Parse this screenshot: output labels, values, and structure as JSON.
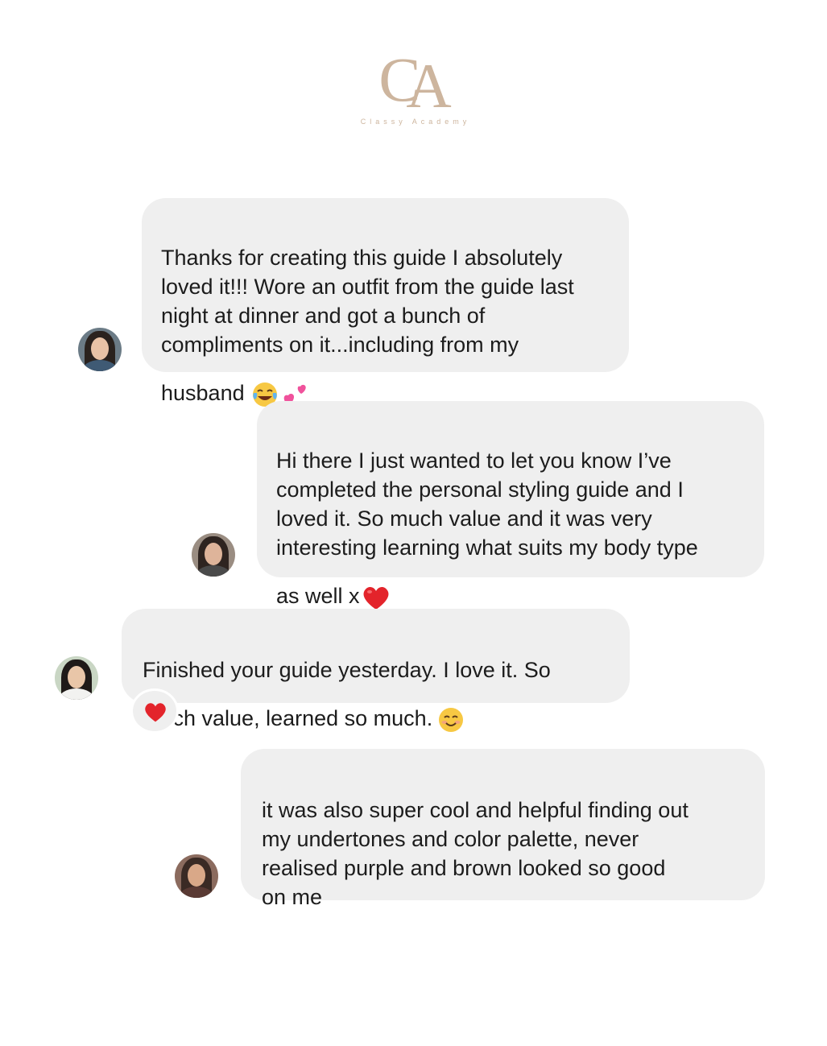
{
  "brand": {
    "monogram_c": "C",
    "monogram_a": "A",
    "name": "Classy Academy",
    "color": "#cdb59e"
  },
  "messages": [
    {
      "side": "left",
      "text": "Thanks for creating this guide I absolutely\nloved it!!! Wore an outfit from the guide last\nnight at dinner and got a bunch of\ncompliments on it...including from my\nhusband",
      "trailing_icons": [
        "tears-of-joy-emoji",
        "two-hearts-emoji"
      ]
    },
    {
      "side": "right",
      "text": "Hi there I just wanted to let you know I’ve\ncompleted the personal styling guide and I\nloved it. So much value and it was very\ninteresting learning what suits my body type\nas well x",
      "trailing_icons": [
        "red-heart-emoji"
      ]
    },
    {
      "side": "left",
      "text": "Finished your guide yesterday. I love it. So\nmuch value, learned so much.",
      "trailing_icons": [
        "smiling-face-emoji"
      ],
      "reaction": "red-heart-emoji"
    },
    {
      "side": "right",
      "text": "it was also super cool and helpful finding out\nmy undertones and color palette, never\nrealised purple and brown looked so good\non me",
      "trailing_icons": []
    }
  ],
  "colors": {
    "bubble": "#efefef",
    "text": "#1c1c1c",
    "heart": "#e3242b"
  }
}
